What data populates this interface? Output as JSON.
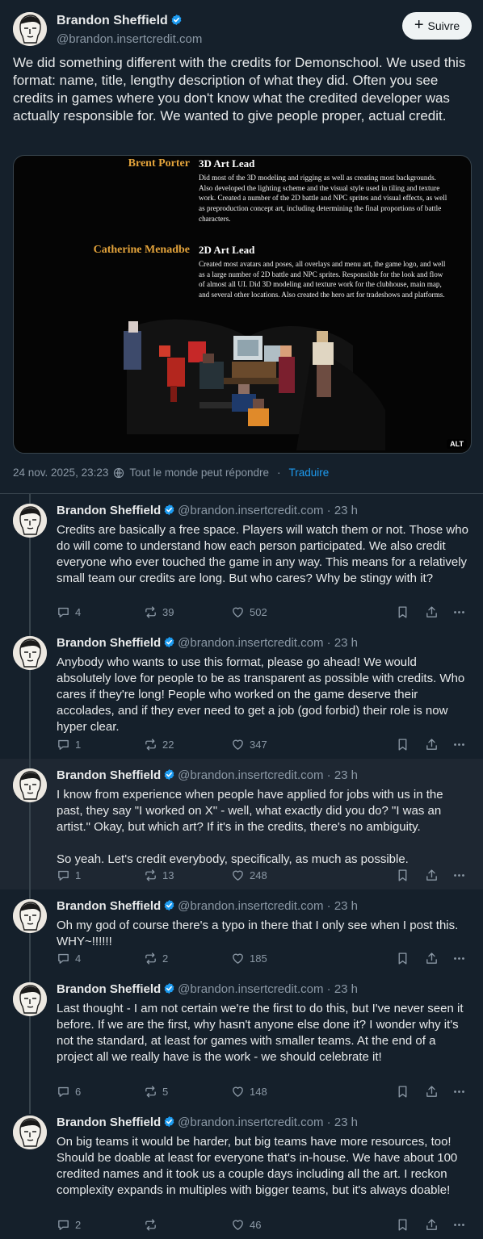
{
  "author": {
    "name": "Brandon Sheffield",
    "handle": "@brandon.insertcredit.com"
  },
  "follow_label": "Suivre",
  "main_post": {
    "text": "We did something different with the credits for Demonschool. We used this format: name, title, lengthy description of what they did. Often you see credits in games where you don't know what the credited developer was actually responsible for. We wanted to give people proper, actual credit.",
    "media": {
      "credits": [
        {
          "name": "Brent Porter",
          "role": "3D Art Lead",
          "description": "Did most of the 3D modeling and rigging as well as creating most backgrounds. Also developed the lighting scheme and the visual style used in tiling and texture work. Created a number of the 2D battle and NPC sprites and visual effects, as well as preproduction concept art, including determining the final proportions of battle characters."
        },
        {
          "name": "Catherine Menadbe",
          "role": "2D Art Lead",
          "description": "Created most avatars and poses, all overlays and menu art, the game logo, and well as a large number of 2D battle and NPC sprites. Responsible for the look and flow of almost all UI. Did 3D modeling and texture work for the clubhouse, main map, and several other locations. Also created the hero art for tradeshows and platforms."
        }
      ],
      "alt_badge": "ALT"
    },
    "timestamp": "24 nov. 2025, 23:23",
    "reply_setting": "Tout le monde peut répondre",
    "separator": "·",
    "translate_label": "Traduire"
  },
  "replies": [
    {
      "time": "23 h",
      "text": [
        "Credits are basically a free space. Players will watch them or not. Those who do will come to understand how each person participated. We also credit everyone who ever touched the game in any way. This means for a relatively small team our credits are long. But who cares? Why be stingy with it?"
      ],
      "replies": "4",
      "reposts": "39",
      "likes": "502"
    },
    {
      "time": "23 h",
      "text": [
        "Anybody who wants to use this format, please go ahead! We would absolutely love for people to be as transparent as possible with credits. Who cares if they're long! People who worked on the game deserve their accolades, and if they ever need to get a job (god forbid) their role is now hyper clear."
      ],
      "replies": "1",
      "reposts": "22",
      "likes": "347"
    },
    {
      "time": "23 h",
      "text": [
        "I know from experience when people have applied for jobs with us in the past, they say \"I worked on X\" - well, what exactly did you do? \"I was an artist.\" Okay, but which art? If it's in the credits, there's no ambiguity.",
        "So yeah. Let's credit everybody, specifically, as much as possible."
      ],
      "replies": "1",
      "reposts": "13",
      "likes": "248"
    },
    {
      "time": "23 h",
      "text": [
        "Oh my god of course there's a typo in there that I only see when I post this. WHY~!!!!!!"
      ],
      "replies": "4",
      "reposts": "2",
      "likes": "185"
    },
    {
      "time": "23 h",
      "text": [
        "Last thought - I am not certain we're the first to do this, but I've never seen it before. If we are the first, why hasn't anyone else done it? I wonder why it's not the standard, at least for games with smaller teams. At the end of a project all we really have is the work - we should celebrate it!"
      ],
      "replies": "6",
      "reposts": "5",
      "likes": "148"
    },
    {
      "time": "23 h",
      "text": [
        "On big teams it would be harder, but big teams have more resources, too! Should be doable at least for everyone that's in-house. We have about 100 credited names and it took us a couple days including all the art. I reckon complexity expands in multiples with bigger teams, but it's always doable!"
      ],
      "replies": "2",
      "reposts": "",
      "likes": "46"
    }
  ],
  "colors": {
    "background": "#15202b",
    "highlight_row": "#1e2732",
    "text": "#e7e9ea",
    "muted": "#8b98a5",
    "link": "#1d9bf0",
    "verified": "#1d9bf0",
    "credit_name": "#e3a33b"
  },
  "icons": [
    "verified-badge-icon",
    "plus-icon",
    "globe-icon",
    "reply-icon",
    "repost-icon",
    "like-icon",
    "bookmark-icon",
    "share-icon",
    "more-icon"
  ]
}
